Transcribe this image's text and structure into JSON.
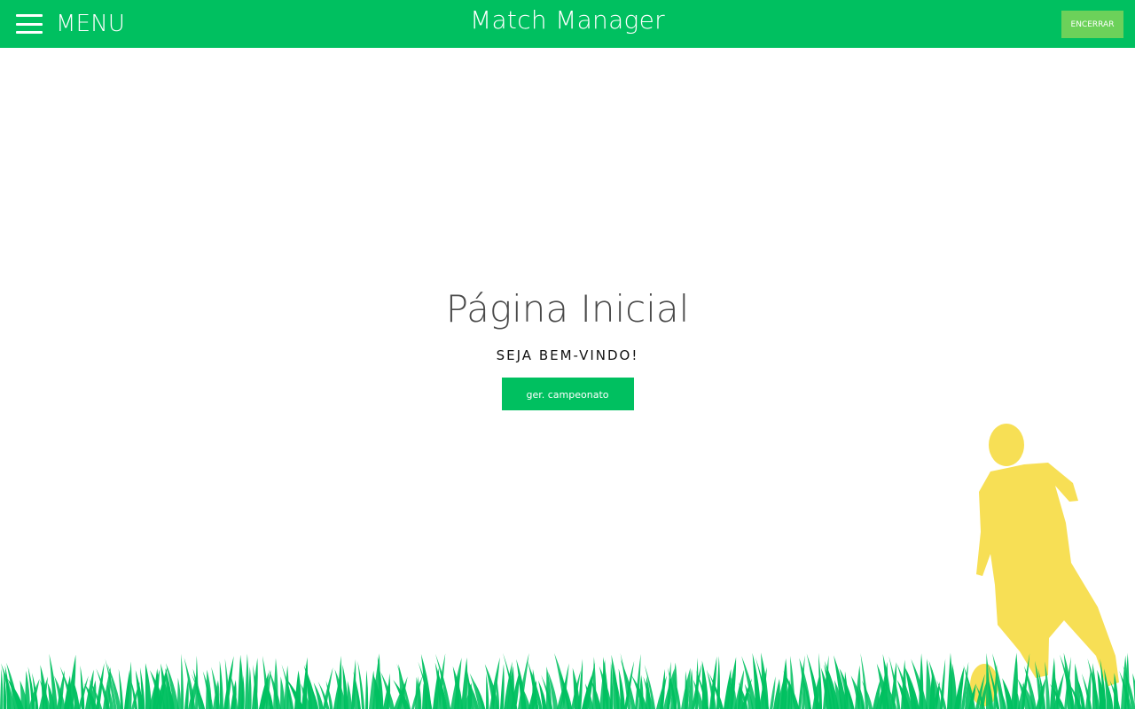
{
  "header": {
    "menu_label": "MENU",
    "app_title": "Match Manager",
    "logout_label": "ENCERRAR"
  },
  "main": {
    "title": "Página Inicial",
    "welcome": "SEJA BEM-VINDO!",
    "action_label": "ger. campeonato"
  },
  "colors": {
    "brand_green": "#00c060",
    "logout_green": "#6cd15a",
    "player_yellow": "#f7df55",
    "grass_green": "#00c060"
  },
  "icons": {
    "menu": "hamburger-icon",
    "decor_player": "soccer-player-silhouette",
    "decor_grass": "grass"
  }
}
